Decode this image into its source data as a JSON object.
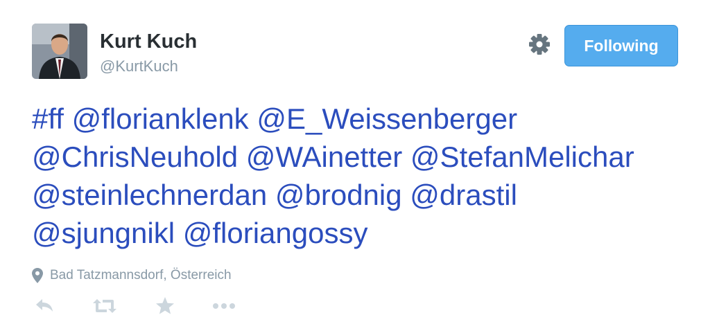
{
  "author": {
    "name": "Kurt Kuch",
    "handle": "@KurtKuch"
  },
  "follow_button": {
    "label": "Following"
  },
  "tweet": {
    "lines": [
      [
        "#ff",
        "@florianklenk",
        "@E_Weissenberger"
      ],
      [
        "@ChrisNeuhold",
        "@WAinetter",
        "@StefanMelichar"
      ],
      [
        "@steinlechnerdan",
        "@brodnig",
        "@drastil"
      ],
      [
        "@sjungnikl",
        "@floriangossy"
      ]
    ]
  },
  "location": {
    "text": "Bad Tatzmannsdorf, Österreich"
  },
  "icons": {
    "gear": "gear-icon",
    "location": "map-pin-icon",
    "reply": "reply-icon",
    "retweet": "retweet-icon",
    "favorite": "star-icon",
    "more": "more-dots-icon"
  },
  "colors": {
    "link": "#2b4dbd",
    "name": "#292f33",
    "muted": "#8899a6",
    "button": "#55acee",
    "action_icons": "#ccd6dd"
  }
}
